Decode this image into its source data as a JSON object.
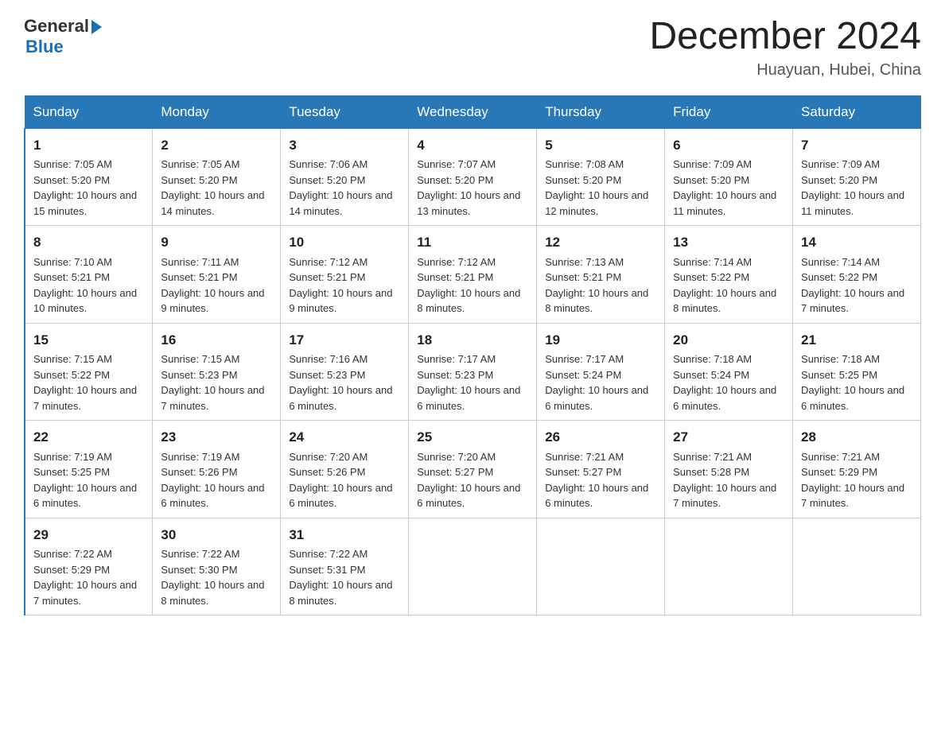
{
  "header": {
    "logo_text_general": "General",
    "logo_text_blue": "Blue",
    "title": "December 2024",
    "subtitle": "Huayuan, Hubei, China"
  },
  "days_of_week": [
    "Sunday",
    "Monday",
    "Tuesday",
    "Wednesday",
    "Thursday",
    "Friday",
    "Saturday"
  ],
  "weeks": [
    [
      {
        "day": "1",
        "sunrise": "7:05 AM",
        "sunset": "5:20 PM",
        "daylight": "10 hours and 15 minutes."
      },
      {
        "day": "2",
        "sunrise": "7:05 AM",
        "sunset": "5:20 PM",
        "daylight": "10 hours and 14 minutes."
      },
      {
        "day": "3",
        "sunrise": "7:06 AM",
        "sunset": "5:20 PM",
        "daylight": "10 hours and 14 minutes."
      },
      {
        "day": "4",
        "sunrise": "7:07 AM",
        "sunset": "5:20 PM",
        "daylight": "10 hours and 13 minutes."
      },
      {
        "day": "5",
        "sunrise": "7:08 AM",
        "sunset": "5:20 PM",
        "daylight": "10 hours and 12 minutes."
      },
      {
        "day": "6",
        "sunrise": "7:09 AM",
        "sunset": "5:20 PM",
        "daylight": "10 hours and 11 minutes."
      },
      {
        "day": "7",
        "sunrise": "7:09 AM",
        "sunset": "5:20 PM",
        "daylight": "10 hours and 11 minutes."
      }
    ],
    [
      {
        "day": "8",
        "sunrise": "7:10 AM",
        "sunset": "5:21 PM",
        "daylight": "10 hours and 10 minutes."
      },
      {
        "day": "9",
        "sunrise": "7:11 AM",
        "sunset": "5:21 PM",
        "daylight": "10 hours and 9 minutes."
      },
      {
        "day": "10",
        "sunrise": "7:12 AM",
        "sunset": "5:21 PM",
        "daylight": "10 hours and 9 minutes."
      },
      {
        "day": "11",
        "sunrise": "7:12 AM",
        "sunset": "5:21 PM",
        "daylight": "10 hours and 8 minutes."
      },
      {
        "day": "12",
        "sunrise": "7:13 AM",
        "sunset": "5:21 PM",
        "daylight": "10 hours and 8 minutes."
      },
      {
        "day": "13",
        "sunrise": "7:14 AM",
        "sunset": "5:22 PM",
        "daylight": "10 hours and 8 minutes."
      },
      {
        "day": "14",
        "sunrise": "7:14 AM",
        "sunset": "5:22 PM",
        "daylight": "10 hours and 7 minutes."
      }
    ],
    [
      {
        "day": "15",
        "sunrise": "7:15 AM",
        "sunset": "5:22 PM",
        "daylight": "10 hours and 7 minutes."
      },
      {
        "day": "16",
        "sunrise": "7:15 AM",
        "sunset": "5:23 PM",
        "daylight": "10 hours and 7 minutes."
      },
      {
        "day": "17",
        "sunrise": "7:16 AM",
        "sunset": "5:23 PM",
        "daylight": "10 hours and 6 minutes."
      },
      {
        "day": "18",
        "sunrise": "7:17 AM",
        "sunset": "5:23 PM",
        "daylight": "10 hours and 6 minutes."
      },
      {
        "day": "19",
        "sunrise": "7:17 AM",
        "sunset": "5:24 PM",
        "daylight": "10 hours and 6 minutes."
      },
      {
        "day": "20",
        "sunrise": "7:18 AM",
        "sunset": "5:24 PM",
        "daylight": "10 hours and 6 minutes."
      },
      {
        "day": "21",
        "sunrise": "7:18 AM",
        "sunset": "5:25 PM",
        "daylight": "10 hours and 6 minutes."
      }
    ],
    [
      {
        "day": "22",
        "sunrise": "7:19 AM",
        "sunset": "5:25 PM",
        "daylight": "10 hours and 6 minutes."
      },
      {
        "day": "23",
        "sunrise": "7:19 AM",
        "sunset": "5:26 PM",
        "daylight": "10 hours and 6 minutes."
      },
      {
        "day": "24",
        "sunrise": "7:20 AM",
        "sunset": "5:26 PM",
        "daylight": "10 hours and 6 minutes."
      },
      {
        "day": "25",
        "sunrise": "7:20 AM",
        "sunset": "5:27 PM",
        "daylight": "10 hours and 6 minutes."
      },
      {
        "day": "26",
        "sunrise": "7:21 AM",
        "sunset": "5:27 PM",
        "daylight": "10 hours and 6 minutes."
      },
      {
        "day": "27",
        "sunrise": "7:21 AM",
        "sunset": "5:28 PM",
        "daylight": "10 hours and 7 minutes."
      },
      {
        "day": "28",
        "sunrise": "7:21 AM",
        "sunset": "5:29 PM",
        "daylight": "10 hours and 7 minutes."
      }
    ],
    [
      {
        "day": "29",
        "sunrise": "7:22 AM",
        "sunset": "5:29 PM",
        "daylight": "10 hours and 7 minutes."
      },
      {
        "day": "30",
        "sunrise": "7:22 AM",
        "sunset": "5:30 PM",
        "daylight": "10 hours and 8 minutes."
      },
      {
        "day": "31",
        "sunrise": "7:22 AM",
        "sunset": "5:31 PM",
        "daylight": "10 hours and 8 minutes."
      },
      null,
      null,
      null,
      null
    ]
  ],
  "labels": {
    "sunrise": "Sunrise: ",
    "sunset": "Sunset: ",
    "daylight": "Daylight: "
  }
}
